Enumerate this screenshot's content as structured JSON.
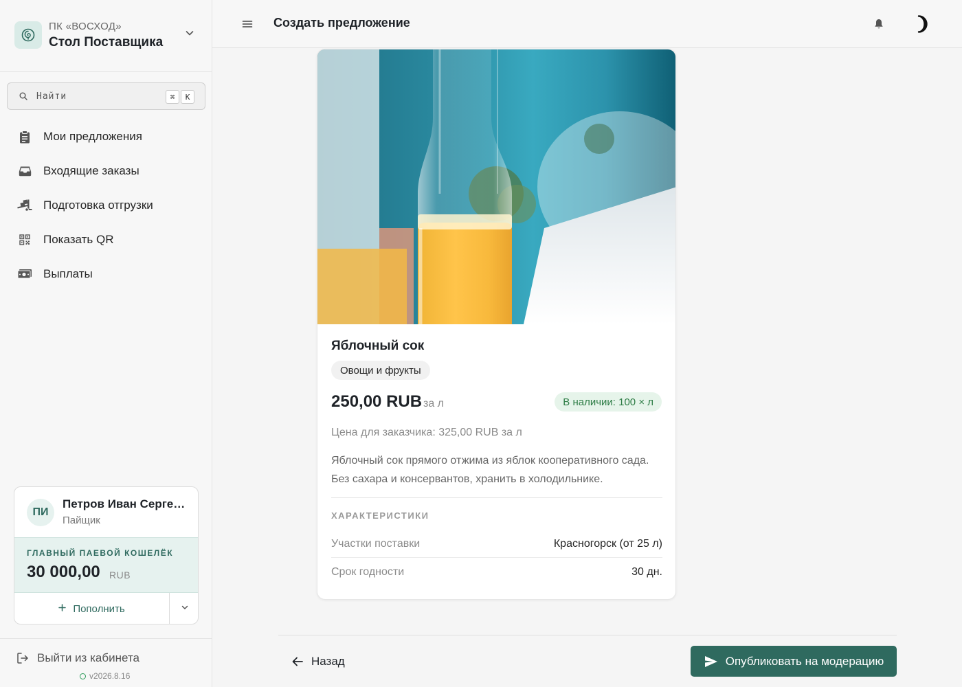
{
  "brand": {
    "org": "ПК «ВОСХОД»",
    "name": "Стол Поставщика"
  },
  "search": {
    "placeholder": "Найти",
    "kbd_modifier": "⌘",
    "kbd_key": "K"
  },
  "sidebar": {
    "items": [
      {
        "label": "Мои предложения",
        "icon": "clipboard-icon"
      },
      {
        "label": "Входящие заказы",
        "icon": "inbox-icon"
      },
      {
        "label": "Подготовка отгрузки",
        "icon": "truck-loading-icon"
      },
      {
        "label": "Показать QR",
        "icon": "qr-code-icon"
      },
      {
        "label": "Выплаты",
        "icon": "money-bill-icon"
      }
    ]
  },
  "user": {
    "initials": "ПИ",
    "name": "Петров Иван Сергеевич",
    "role": "Пайщик",
    "wallet_label": "ГЛАВНЫЙ ПАЕВОЙ КОШЕЛЁК",
    "wallet_amount": "30 000,00",
    "wallet_currency": "RUB",
    "topup_label": "Пополнить"
  },
  "logout": {
    "label": "Выйти из кабинета"
  },
  "version": "v2026.8.16",
  "header": {
    "title": "Создать предложение"
  },
  "product": {
    "title": "Яблочный сок",
    "category": "Овощи и фрукты",
    "price": "250,00 RUB",
    "price_unit": "за л",
    "stock": "В наличии: 100 × л",
    "customer_price": "Цена для заказчика: 325,00 RUB за л",
    "description": "Яблочный сок прямого отжима из яблок кооперативного сада. Без сахара и консервантов, хранить в холодильнике.",
    "specs_heading": "ХАРАКТЕРИСТИКИ",
    "specs": [
      {
        "key": "Участки поставки",
        "value": "Красногорск (от 25 л)"
      },
      {
        "key": "Срок годности",
        "value": "30 дн."
      }
    ]
  },
  "actions": {
    "back_label": "Назад",
    "publish_label": "Опубликовать на модерацию"
  },
  "colors": {
    "accent": "#2f6a5f",
    "accent_light": "#e6f2ef",
    "stock_bg": "#e6f4ea",
    "stock_text": "#2e7d46"
  }
}
